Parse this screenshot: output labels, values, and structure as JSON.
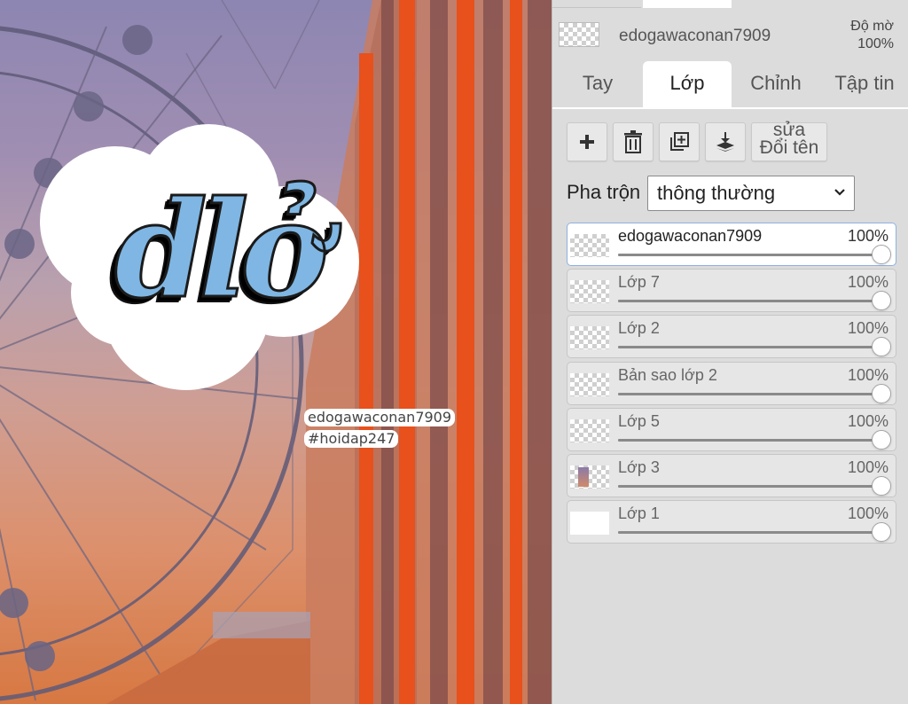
{
  "canvas": {
    "artwork_text": "dlở",
    "sticker_line1": "edogawaconan7909",
    "sticker_line2": "#hoidap247"
  },
  "panel": {
    "current_layer_name": "edogawaconan7909",
    "opacity_label_line1": "Độ mờ",
    "opacity_label_line2": "100%",
    "tabs": [
      {
        "label": "Tay",
        "active": false
      },
      {
        "label": "Lớp",
        "active": true
      },
      {
        "label": "Chỉnh",
        "active": false
      },
      {
        "label": "Tập tin",
        "active": false
      }
    ],
    "toolbar": {
      "add_icon": "plus-icon",
      "delete_icon": "trash-icon",
      "duplicate_icon": "duplicate-icon",
      "merge_icon": "merge-down-icon",
      "rename_line1": "sửa",
      "rename_line2": "Đổi tên"
    },
    "blend": {
      "label": "Pha trộn",
      "value": "thông thường"
    },
    "layers": [
      {
        "name": "edogawaconan7909",
        "opacity": "100%",
        "value": 1.0,
        "active": true
      },
      {
        "name": "Lớp 7",
        "opacity": "100%",
        "value": 1.0,
        "active": false
      },
      {
        "name": "Lớp 2",
        "opacity": "100%",
        "value": 1.0,
        "active": false
      },
      {
        "name": "Bản sao lớp 2",
        "opacity": "100%",
        "value": 1.0,
        "active": false
      },
      {
        "name": "Lớp 5",
        "opacity": "100%",
        "value": 1.0,
        "active": false
      },
      {
        "name": "Lớp 3",
        "opacity": "100%",
        "value": 1.0,
        "active": false
      },
      {
        "name": "Lớp 1",
        "opacity": "100%",
        "value": 1.0,
        "active": false
      }
    ]
  },
  "colors": {
    "accent_active_border": "#8fb0e0",
    "panel_bg": "#dcdcdc"
  }
}
